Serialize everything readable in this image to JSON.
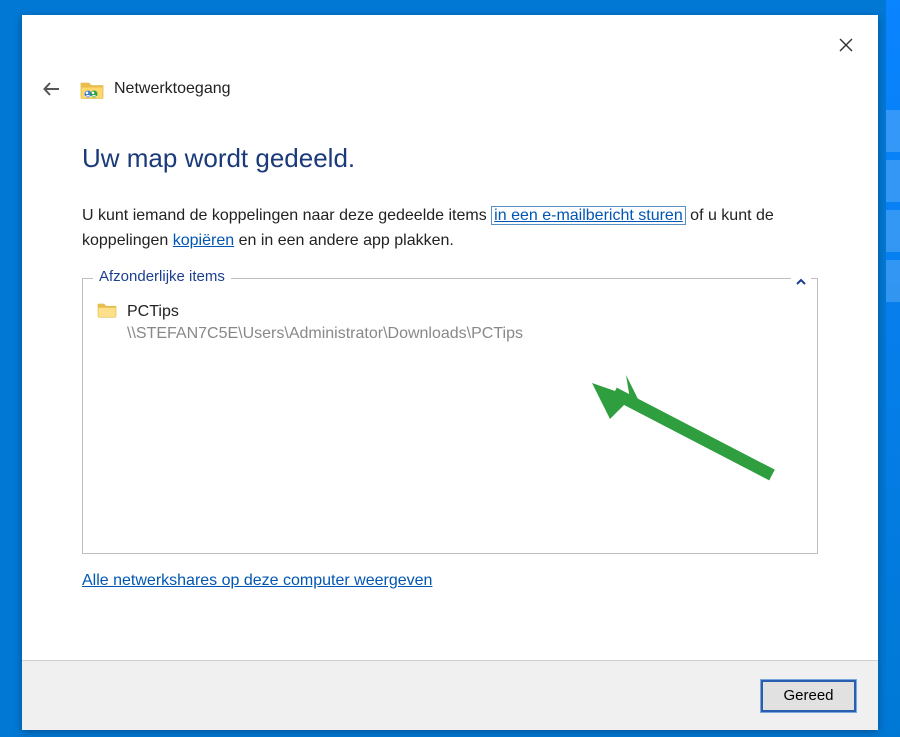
{
  "header": {
    "wizard_title": "Netwerktoegang"
  },
  "main": {
    "heading": "Uw map wordt gedeeld.",
    "desc_prefix": "U kunt iemand de koppelingen naar deze gedeelde items ",
    "email_link": "in een e-mailbericht sturen",
    "desc_middle": " of u kunt de koppelingen ",
    "copy_link": "kopiëren",
    "desc_suffix": " en in een andere app plakken.",
    "group_legend": "Afzonderlijke items",
    "item": {
      "name": "PCTips",
      "path": "\\\\STEFAN7C5E\\Users\\Administrator\\Downloads\\PCTips"
    },
    "shares_link": "Alle netwerkshares op deze computer weergeven"
  },
  "footer": {
    "done_button": "Gereed"
  }
}
